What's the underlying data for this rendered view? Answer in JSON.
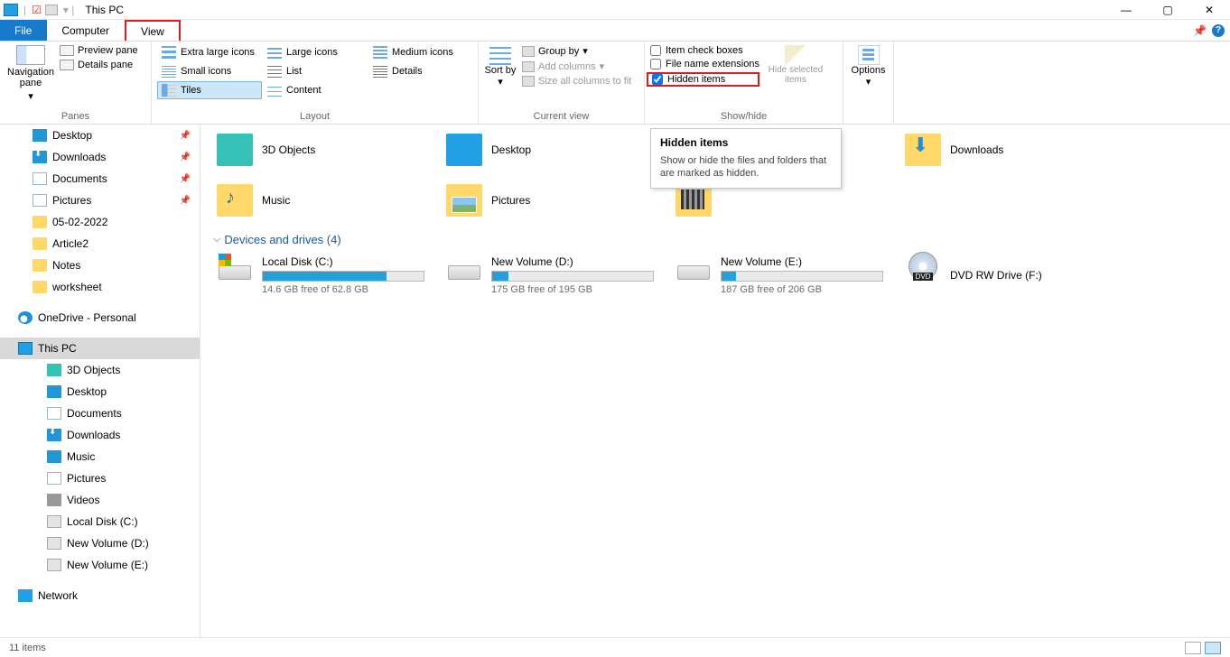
{
  "title": "This PC",
  "tabs": {
    "file": "File",
    "computer": "Computer",
    "view": "View"
  },
  "ribbon": {
    "panes": {
      "nav": "Navigation pane",
      "preview": "Preview pane",
      "details": "Details pane",
      "group": "Panes"
    },
    "layout": {
      "xl": "Extra large icons",
      "lg": "Large icons",
      "md": "Medium icons",
      "sm": "Small icons",
      "ls": "List",
      "dt": "Details",
      "tl": "Tiles",
      "ct": "Content",
      "group": "Layout"
    },
    "currentview": {
      "sort": "Sort by",
      "group_by": "Group by",
      "add_cols": "Add columns",
      "size_all": "Size all columns to fit",
      "group": "Current view"
    },
    "showhide": {
      "item_check": "Item check boxes",
      "file_ext": "File name extensions",
      "hidden": "Hidden items",
      "hide_sel": "Hide selected items",
      "group": "Show/hide"
    },
    "options": "Options"
  },
  "tooltip": {
    "title": "Hidden items",
    "body": "Show or hide the files and folders that are marked as hidden."
  },
  "nav": {
    "desktop": "Desktop",
    "downloads": "Downloads",
    "documents": "Documents",
    "pictures": "Pictures",
    "f1": "05-02-2022",
    "f2": "Article2",
    "f3": "Notes",
    "f4": "worksheet",
    "onedrive": "OneDrive - Personal",
    "thispc": "This PC",
    "obj3d": "3D Objects",
    "desk2": "Desktop",
    "doc2": "Documents",
    "dl2": "Downloads",
    "music": "Music",
    "pic2": "Pictures",
    "videos": "Videos",
    "cdrive": "Local Disk (C:)",
    "ddrive": "New Volume (D:)",
    "edrive": "New Volume (E:)",
    "network": "Network"
  },
  "folders": {
    "d3": "3D Objects",
    "desk": "Desktop",
    "dl": "Downloads",
    "music": "Music",
    "pic": "Pictures",
    "vid": "Videos"
  },
  "devices_hdr": "Devices and drives (4)",
  "drives": {
    "c": {
      "name": "Local Disk (C:)",
      "free": "14.6 GB free of 62.8 GB",
      "pct": 77
    },
    "d": {
      "name": "New Volume (D:)",
      "free": "175 GB free of 195 GB",
      "pct": 10
    },
    "e": {
      "name": "New Volume (E:)",
      "free": "187 GB free of 206 GB",
      "pct": 9
    },
    "f": {
      "name": "DVD RW Drive (F:)"
    }
  },
  "status": "11 items"
}
